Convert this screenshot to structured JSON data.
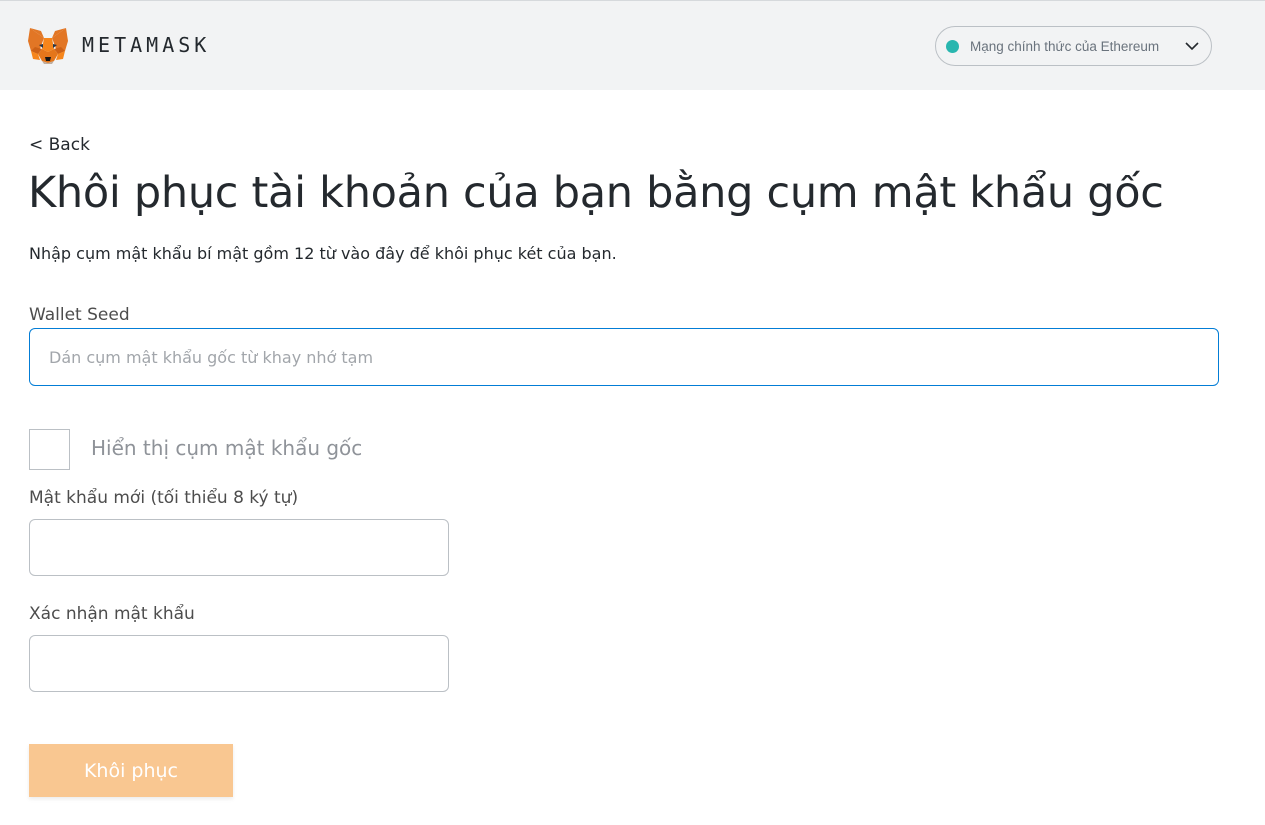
{
  "header": {
    "brand": "METAMASK",
    "network": {
      "label": "Mạng chính thức của Ethereum",
      "status_color": "#29b6af"
    }
  },
  "page": {
    "back_label": "< Back",
    "title": "Khôi phục tài khoản của bạn bằng cụm mật khẩu gốc",
    "subtitle": "Nhập cụm mật khẩu bí mật gồm 12 từ vào đây để khôi phục két của bạn."
  },
  "form": {
    "seed": {
      "label": "Wallet Seed",
      "placeholder": "Dán cụm mật khẩu gốc từ khay nhớ tạm",
      "value": ""
    },
    "show_seed": {
      "label": "Hiển thị cụm mật khẩu gốc",
      "checked": false
    },
    "new_password": {
      "label": "Mật khẩu mới (tối thiểu 8 ký tự)",
      "value": ""
    },
    "confirm_password": {
      "label": "Xác nhận mật khẩu",
      "value": ""
    },
    "submit": {
      "label": "Khôi phục",
      "color": "#f9c791",
      "disabled": true
    }
  },
  "icons": {
    "logo": "metamask-fox-icon",
    "network_chevron": "chevron-down-icon"
  }
}
